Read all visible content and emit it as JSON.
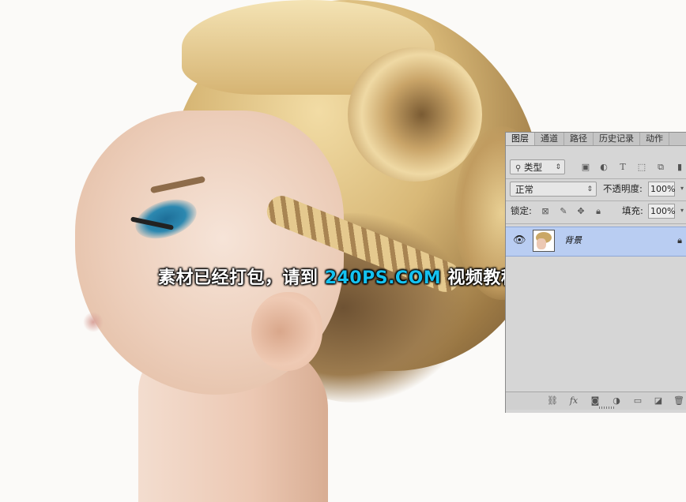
{
  "caption": {
    "prefix": "素材已经打包，请到",
    "site": "240PS.COM",
    "suffix": "视频教程下载",
    "accent_color": "#15c2f0"
  },
  "layers_panel": {
    "tabs": [
      "图层",
      "通道",
      "路径",
      "历史记录",
      "动作"
    ],
    "active_tab": "图层",
    "filter": {
      "label": "类型",
      "icon": "search-icon"
    },
    "filter_icons": [
      "image-filter-icon",
      "adjustment-filter-icon",
      "type-filter-icon",
      "shape-filter-icon",
      "smart-object-filter-icon"
    ],
    "blend_mode": "正常",
    "opacity_label": "不透明度:",
    "opacity_value": "100%",
    "lock_label": "锁定:",
    "lock_icons": [
      "lock-transparent-icon",
      "lock-image-icon",
      "lock-position-icon",
      "lock-all-icon"
    ],
    "fill_label": "填充:",
    "fill_value": "100%",
    "layers": [
      {
        "name": "背景",
        "visible": true,
        "locked": true,
        "selected": true
      }
    ],
    "footer_icons": [
      "link-icon",
      "fx-icon",
      "mask-icon",
      "adjustment-icon",
      "group-folder-icon",
      "new-layer-icon",
      "trash-icon"
    ],
    "selection_color": "#b9cdf2"
  }
}
